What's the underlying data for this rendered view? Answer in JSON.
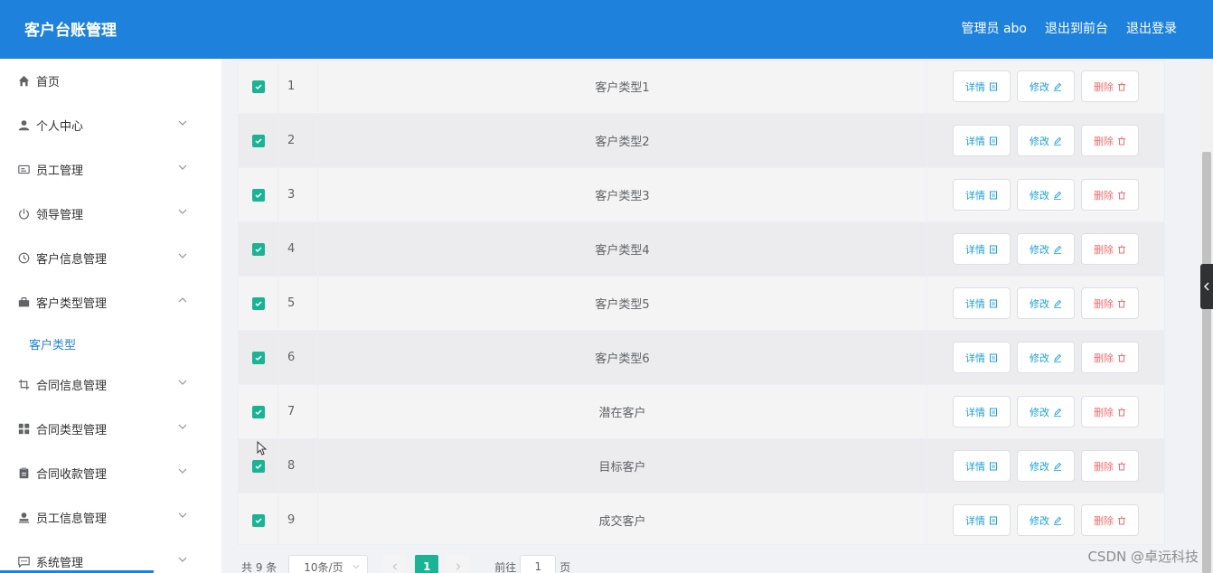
{
  "header": {
    "title": "客户台账管理",
    "nav": [
      "管理员 abo",
      "退出到前台",
      "退出登录"
    ]
  },
  "sidebar": {
    "items": [
      {
        "label": "首页",
        "icon": "home-icon",
        "chevron": false
      },
      {
        "label": "个人中心",
        "icon": "user-icon",
        "chevron": "down"
      },
      {
        "label": "员工管理",
        "icon": "id-card-icon",
        "chevron": "down"
      },
      {
        "label": "领导管理",
        "icon": "power-icon",
        "chevron": "down"
      },
      {
        "label": "客户信息管理",
        "icon": "clock-icon",
        "chevron": "down"
      },
      {
        "label": "客户类型管理",
        "icon": "briefcase-icon",
        "chevron": "up"
      },
      {
        "label": "合同信息管理",
        "icon": "crop-icon",
        "chevron": "down"
      },
      {
        "label": "合同类型管理",
        "icon": "grid-icon",
        "chevron": "down"
      },
      {
        "label": "合同收款管理",
        "icon": "clipboard-icon",
        "chevron": "down"
      },
      {
        "label": "员工信息管理",
        "icon": "stamp-icon",
        "chevron": "down"
      },
      {
        "label": "系统管理",
        "icon": "chat-icon",
        "chevron": "down"
      }
    ],
    "submenu": {
      "label": "客户类型"
    }
  },
  "table": {
    "rows": [
      {
        "index": "1",
        "name": "客户类型1"
      },
      {
        "index": "2",
        "name": "客户类型2"
      },
      {
        "index": "3",
        "name": "客户类型3"
      },
      {
        "index": "4",
        "name": "客户类型4"
      },
      {
        "index": "5",
        "name": "客户类型5"
      },
      {
        "index": "6",
        "name": "客户类型6"
      },
      {
        "index": "7",
        "name": "潜在客户"
      },
      {
        "index": "8",
        "name": "目标客户"
      },
      {
        "index": "9",
        "name": "成交客户"
      }
    ],
    "actions": {
      "detail": "详情",
      "edit": "修改",
      "delete": "删除"
    }
  },
  "pagination": {
    "total": "共 9 条",
    "page_size": "10条/页",
    "current_page": "1",
    "goto_prefix": "前往",
    "goto_value": "1",
    "goto_suffix": "页"
  },
  "watermark": "CSDN @卓远科技",
  "colors": {
    "header": "#1e82dd",
    "checkbox": "#1ab394",
    "danger": "#f56c6c",
    "link": "#1e9fd8"
  }
}
